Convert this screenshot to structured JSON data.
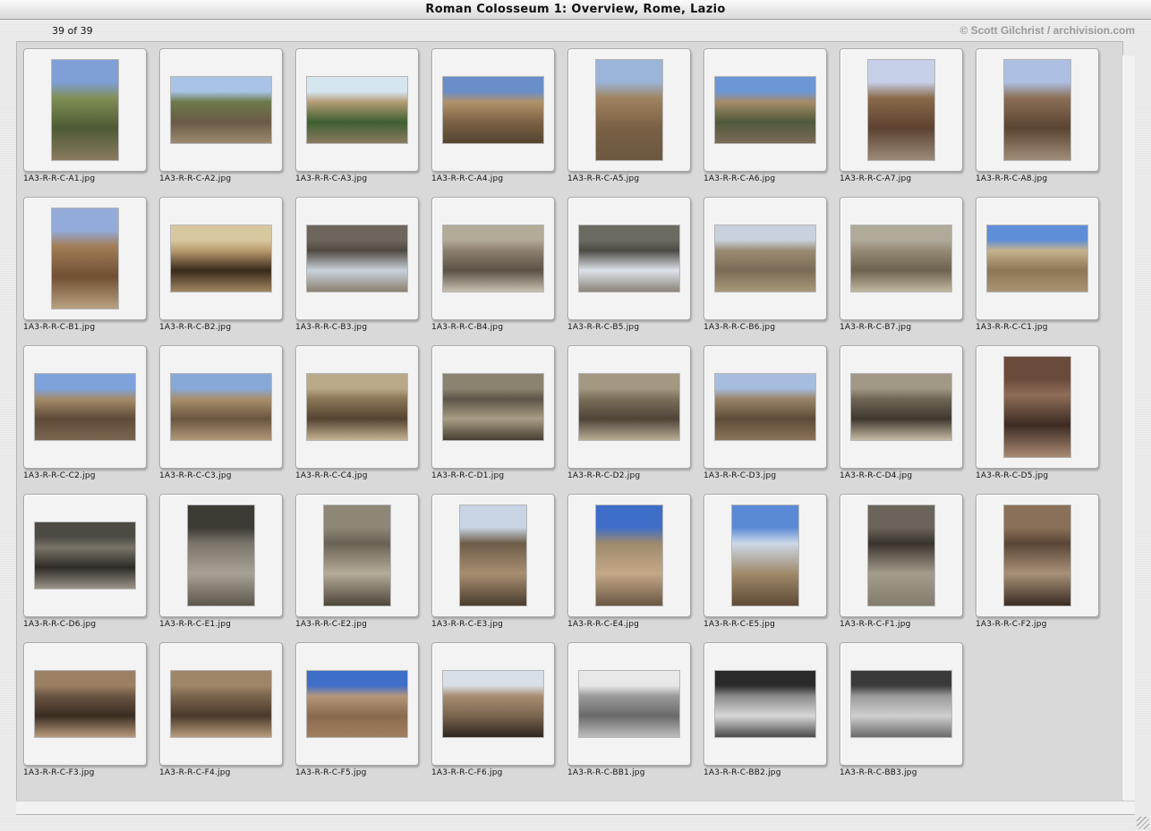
{
  "window": {
    "title": "Roman Colosseum 1: Overview, Rome, Lazio"
  },
  "header": {
    "counter": "39 of 39",
    "credit": "© Scott Gilchrist / archivision.com"
  },
  "thumbnails": [
    {
      "filename": "1A3-R-R-C-A1.jpg",
      "orientation": "portrait",
      "palette": [
        "#7f9fd6",
        "#7f8f55",
        "#4d5a33",
        "#8a7a60"
      ]
    },
    {
      "filename": "1A3-R-R-C-A2.jpg",
      "orientation": "landscape",
      "palette": [
        "#a9c3e6",
        "#6c7a4a",
        "#6b5a45",
        "#9c8a70"
      ]
    },
    {
      "filename": "1A3-R-R-C-A3.jpg",
      "orientation": "landscape",
      "palette": [
        "#d6e6f0",
        "#b49c74",
        "#3f5f32",
        "#8a7a60"
      ]
    },
    {
      "filename": "1A3-R-R-C-A4.jpg",
      "orientation": "landscape",
      "palette": [
        "#6a8ec9",
        "#b0926a",
        "#7c6245",
        "#54442f"
      ]
    },
    {
      "filename": "1A3-R-R-C-A5.jpg",
      "orientation": "portrait",
      "palette": [
        "#9bb4d9",
        "#a0835f",
        "#7a6045",
        "#6b5840"
      ]
    },
    {
      "filename": "1A3-R-R-C-A6.jpg",
      "orientation": "landscape",
      "palette": [
        "#6d96d6",
        "#a58b68",
        "#4f5a3a",
        "#7a6a56"
      ]
    },
    {
      "filename": "1A3-R-R-C-A7.jpg",
      "orientation": "portrait",
      "palette": [
        "#c6d0e8",
        "#8a6a4a",
        "#5c4230",
        "#9c8a78"
      ]
    },
    {
      "filename": "1A3-R-R-C-A8.jpg",
      "orientation": "portrait",
      "palette": [
        "#aebfe4",
        "#8b6f55",
        "#5a4432",
        "#a08d7a"
      ]
    },
    {
      "filename": "1A3-R-R-C-B1.jpg",
      "orientation": "portrait",
      "palette": [
        "#93abd9",
        "#a27c55",
        "#704f33",
        "#b8a282"
      ]
    },
    {
      "filename": "1A3-R-R-C-B2.jpg",
      "orientation": "landscape",
      "palette": [
        "#d8c8a0",
        "#b99b6f",
        "#3a2a1c",
        "#a08660"
      ]
    },
    {
      "filename": "1A3-R-R-C-B3.jpg",
      "orientation": "landscape",
      "palette": [
        "#6e665c",
        "#50493f",
        "#c9d2dc",
        "#8a8070"
      ]
    },
    {
      "filename": "1A3-R-R-C-B4.jpg",
      "orientation": "landscape",
      "palette": [
        "#b3aa98",
        "#8e8070",
        "#5a5046",
        "#c8c0b0"
      ]
    },
    {
      "filename": "1A3-R-R-C-B5.jpg",
      "orientation": "landscape",
      "palette": [
        "#6d6a62",
        "#4d4a44",
        "#dde3ea",
        "#8a847a"
      ]
    },
    {
      "filename": "1A3-R-R-C-B6.jpg",
      "orientation": "landscape",
      "palette": [
        "#c8d2de",
        "#9a8b73",
        "#7a6b55",
        "#a89878"
      ]
    },
    {
      "filename": "1A3-R-R-C-B7.jpg",
      "orientation": "landscape",
      "palette": [
        "#b0aa9a",
        "#958a74",
        "#6d624f",
        "#c2b8a0"
      ]
    },
    {
      "filename": "1A3-R-R-C-C1.jpg",
      "orientation": "landscape",
      "palette": [
        "#5e8ed8",
        "#c6b28c",
        "#8c7656",
        "#a89474"
      ]
    },
    {
      "filename": "1A3-R-R-C-C2.jpg",
      "orientation": "landscape",
      "palette": [
        "#7ea3dc",
        "#a48b6a",
        "#5e4a36",
        "#7a6650"
      ]
    },
    {
      "filename": "1A3-R-R-C-C3.jpg",
      "orientation": "landscape",
      "palette": [
        "#88a8d8",
        "#a88e6c",
        "#6a5640",
        "#b09878"
      ]
    },
    {
      "filename": "1A3-R-R-C-C4.jpg",
      "orientation": "landscape",
      "palette": [
        "#b9a988",
        "#8a7556",
        "#544430",
        "#c4b292"
      ]
    },
    {
      "filename": "1A3-R-R-C-D1.jpg",
      "orientation": "landscape",
      "palette": [
        "#8c8270",
        "#5d5548",
        "#a89c84",
        "#463e32"
      ]
    },
    {
      "filename": "1A3-R-R-C-D2.jpg",
      "orientation": "landscape",
      "palette": [
        "#a49880",
        "#7b6e5a",
        "#4e4438",
        "#b8ac94"
      ]
    },
    {
      "filename": "1A3-R-R-C-D3.jpg",
      "orientation": "landscape",
      "palette": [
        "#a7bde0",
        "#9a8468",
        "#5e4c38",
        "#8a7458"
      ]
    },
    {
      "filename": "1A3-R-R-C-D4.jpg",
      "orientation": "landscape",
      "palette": [
        "#a29886",
        "#6f6656",
        "#3f382e",
        "#c4baa4"
      ]
    },
    {
      "filename": "1A3-R-R-C-D5.jpg",
      "orientation": "portrait",
      "palette": [
        "#6a4a3a",
        "#8e6e58",
        "#3c2a22",
        "#a88a72"
      ]
    },
    {
      "filename": "1A3-R-R-C-D6.jpg",
      "orientation": "landscape",
      "palette": [
        "#4e4a44",
        "#7a7468",
        "#2e2a26",
        "#9a9488"
      ]
    },
    {
      "filename": "1A3-R-R-C-E1.jpg",
      "orientation": "portrait",
      "palette": [
        "#3e3a34",
        "#7a746a",
        "#a8a296",
        "#5c564c"
      ]
    },
    {
      "filename": "1A3-R-R-C-E2.jpg",
      "orientation": "portrait",
      "palette": [
        "#8e8676",
        "#6a6254",
        "#b4ab98",
        "#4e463a"
      ]
    },
    {
      "filename": "1A3-R-R-C-E3.jpg",
      "orientation": "portrait",
      "palette": [
        "#c8d4e4",
        "#6e5c48",
        "#a88e70",
        "#4a3c2e"
      ]
    },
    {
      "filename": "1A3-R-R-C-E4.jpg",
      "orientation": "portrait",
      "palette": [
        "#3f6ec8",
        "#9e8a6c",
        "#c4a888",
        "#6a5844"
      ]
    },
    {
      "filename": "1A3-R-R-C-E5.jpg",
      "orientation": "portrait",
      "palette": [
        "#5a8ad6",
        "#ccd8e8",
        "#a08a6a",
        "#5e4a36"
      ]
    },
    {
      "filename": "1A3-R-R-C-F1.jpg",
      "orientation": "portrait",
      "palette": [
        "#6b645a",
        "#3a342e",
        "#a49c8c",
        "#847c6c"
      ]
    },
    {
      "filename": "1A3-R-R-C-F2.jpg",
      "orientation": "portrait",
      "palette": [
        "#8a7058",
        "#5a4636",
        "#a89078",
        "#3a2c22"
      ]
    },
    {
      "filename": "1A3-R-R-C-F3.jpg",
      "orientation": "landscape",
      "palette": [
        "#9c8064",
        "#6a5442",
        "#3a2c22",
        "#b89a7c"
      ]
    },
    {
      "filename": "1A3-R-R-C-F4.jpg",
      "orientation": "landscape",
      "palette": [
        "#a08668",
        "#7a644c",
        "#4a3a2c",
        "#b89c7c"
      ]
    },
    {
      "filename": "1A3-R-R-C-F5.jpg",
      "orientation": "landscape",
      "palette": [
        "#3f6ec8",
        "#b4967a",
        "#8a6a4e",
        "#a07e60"
      ]
    },
    {
      "filename": "1A3-R-R-C-F6.jpg",
      "orientation": "landscape",
      "palette": [
        "#d8dfe6",
        "#a88e72",
        "#7a644e",
        "#2e2620"
      ]
    },
    {
      "filename": "1A3-R-R-C-BB1.jpg",
      "orientation": "landscape",
      "palette": [
        "#e8e8e8",
        "#9a9a9a",
        "#6a6a6a",
        "#bdbdbd"
      ]
    },
    {
      "filename": "1A3-R-R-C-BB2.jpg",
      "orientation": "landscape",
      "palette": [
        "#2a2a2a",
        "#8a8a8a",
        "#d8d8d8",
        "#4a4a4a"
      ]
    },
    {
      "filename": "1A3-R-R-C-BB3.jpg",
      "orientation": "landscape",
      "palette": [
        "#3a3a3a",
        "#9a9a9a",
        "#cfcfcf",
        "#6a6a6a"
      ]
    }
  ]
}
